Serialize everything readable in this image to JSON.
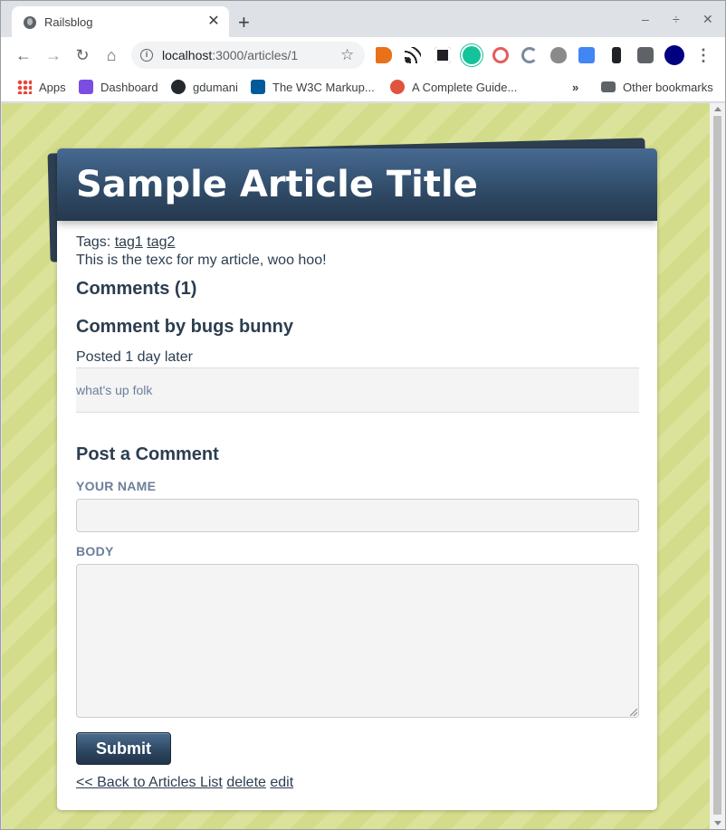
{
  "browser": {
    "tab_title": "Railsblog",
    "tab_close": "✕",
    "new_tab": "+",
    "window_controls": [
      "–",
      "÷",
      "✕"
    ],
    "url_host": "localhost",
    "url_path": ":3000/articles/1",
    "nav": {
      "back": "←",
      "forward": "→",
      "reload": "↻",
      "home": "⌂",
      "star": "☆",
      "info": "i"
    },
    "extensions": [
      {
        "name": "megaphone-ext-icon",
        "color": "#e8711a"
      },
      {
        "name": "rss-ext-icon",
        "color": "#202124"
      },
      {
        "name": "archive-ext-icon",
        "color": "#202124"
      },
      {
        "name": "grammarly-ext-icon",
        "color": "#15c39a"
      },
      {
        "name": "spiral-ext-icon",
        "color": "#e55b5b"
      },
      {
        "name": "refresh-ext-icon",
        "color": "#7a8aa0"
      },
      {
        "name": "bug-ext-icon",
        "color": "#8a8a8a"
      },
      {
        "name": "translate-ext-icon",
        "color": "#4285f4"
      },
      {
        "name": "bookmark-ext-icon",
        "color": "#202124"
      },
      {
        "name": "puzzle-ext-icon",
        "color": "#5f6368"
      },
      {
        "name": "profile-avatar-icon",
        "color": "#000080"
      }
    ],
    "menu": "⋮"
  },
  "bookmarks": [
    {
      "label": "Apps"
    },
    {
      "label": "Dashboard"
    },
    {
      "label": "gdumani"
    },
    {
      "label": "The W3C Markup..."
    },
    {
      "label": "A Complete Guide..."
    }
  ],
  "bookmarks_overflow": "»",
  "other_bookmarks": "Other bookmarks",
  "article": {
    "title": "Sample Article Title",
    "tags_label": "Tags: ",
    "tags": [
      "tag1",
      "tag2"
    ],
    "body": "This is the texc for my article, woo hoo!",
    "comments_heading": "Comments (1)",
    "comments": [
      {
        "heading": "Comment by bugs bunny",
        "posted": "Posted 1 day later",
        "body": "what's up folk"
      }
    ],
    "form": {
      "heading": "Post a Comment",
      "name_label": "YOUR NAME",
      "name_value": "",
      "body_label": "BODY",
      "body_value": "",
      "submit_label": "Submit"
    },
    "links": {
      "back": "<< Back to Articles List",
      "delete": "delete",
      "edit": "edit"
    }
  },
  "colors": {
    "header_dark": "#25384d",
    "header_light": "#476a92",
    "text": "#2c3e50",
    "muted": "#6b7f9a",
    "stripe_a": "#d3dc8a",
    "stripe_b": "#dbe29a"
  }
}
